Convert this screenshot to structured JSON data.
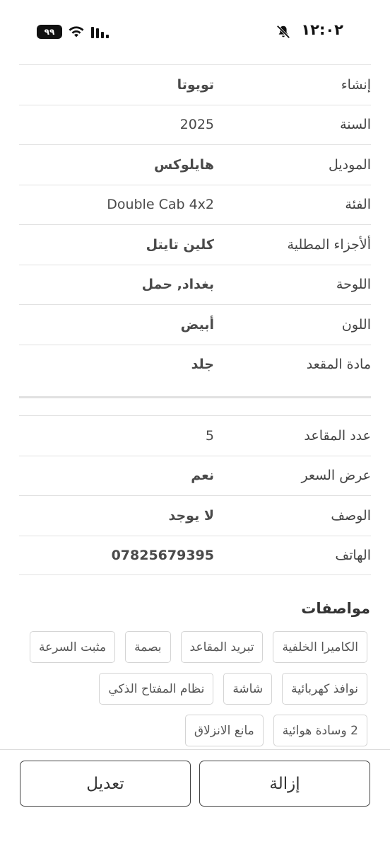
{
  "status_bar": {
    "time": "١٢:٠٢",
    "battery": "٩٩"
  },
  "details_group1": [
    {
      "label": "إنشاء",
      "value": "تويوتا"
    },
    {
      "label": "السنة",
      "value": "2025"
    },
    {
      "label": "الموديل",
      "value": "هايلوكس"
    },
    {
      "label": "الفئة",
      "value": "Double Cab 4x2"
    },
    {
      "label": "ألأجزاء المطلية",
      "value": "كلين تايتل"
    },
    {
      "label": "اللوحة",
      "value": "بغداد, حمل"
    },
    {
      "label": "اللون",
      "value": "أبيض"
    },
    {
      "label": "مادة المقعد",
      "value": "جلد"
    }
  ],
  "details_group2": [
    {
      "label": "عدد المقاعد",
      "value": "5"
    },
    {
      "label": "عرض السعر",
      "value": "نعم"
    },
    {
      "label": "الوصف",
      "value": "لا يوجد"
    },
    {
      "label": "الهاتف",
      "value": "07825679395"
    }
  ],
  "features": {
    "title": "مواصفات",
    "items": [
      "الكاميرا الخلفية",
      "تبريد المقاعد",
      "بصمة",
      "مثبت السرعة",
      "نوافذ كهربائية",
      "شاشة",
      "نظام المفتاح الذكي",
      "2 وسادة هوائية",
      "مانع الانزلاق"
    ]
  },
  "actions": {
    "remove_label": "إزالة",
    "edit_label": "تعديل"
  }
}
